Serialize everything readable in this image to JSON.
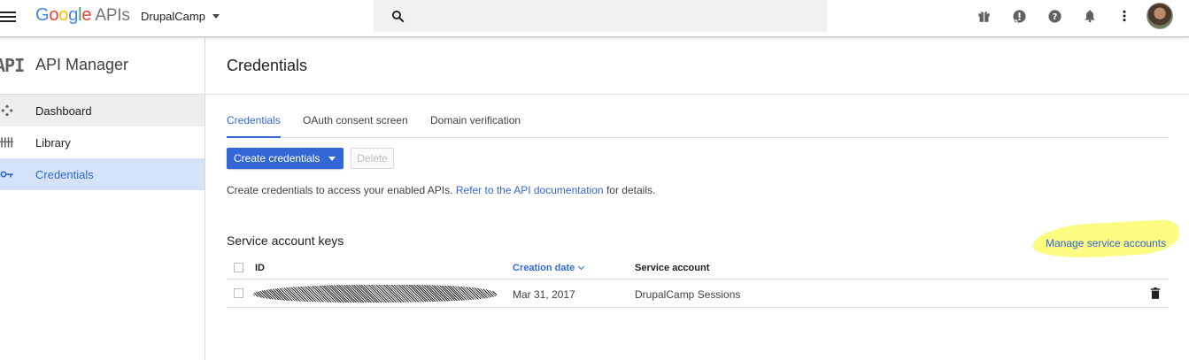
{
  "topbar": {
    "logo_google": [
      "G",
      "o",
      "o",
      "g",
      "l",
      "e"
    ],
    "logo_apis": "APIs",
    "project_name": "DrupalCamp"
  },
  "sidebar": {
    "mark": "API",
    "title": "API Manager",
    "items": [
      {
        "label": "Dashboard",
        "icon": "dashboard-icon"
      },
      {
        "label": "Library",
        "icon": "library-icon"
      },
      {
        "label": "Credentials",
        "icon": "key-icon"
      }
    ]
  },
  "main": {
    "title": "Credentials",
    "tabs": [
      {
        "label": "Credentials",
        "active": true
      },
      {
        "label": "OAuth consent screen",
        "active": false
      },
      {
        "label": "Domain verification",
        "active": false
      }
    ],
    "create_button": "Create credentials",
    "delete_button": "Delete",
    "desc_text": "Create credentials to access your enabled APIs.",
    "desc_link": "Refer to the API documentation",
    "desc_suffix": "for details.",
    "section_title": "Service account keys",
    "manage_link": "Manage service accounts",
    "table": {
      "headers": {
        "id": "ID",
        "creation_date": "Creation date",
        "service_account": "Service account"
      },
      "rows": [
        {
          "id": "",
          "creation_date": "Mar 31, 2017",
          "service_account": "DrupalCamp Sessions"
        }
      ]
    }
  },
  "colors": {
    "accent": "#3367d6",
    "active_nav_bg": "#d4e3fa",
    "highlight": "#fbfb5e"
  }
}
